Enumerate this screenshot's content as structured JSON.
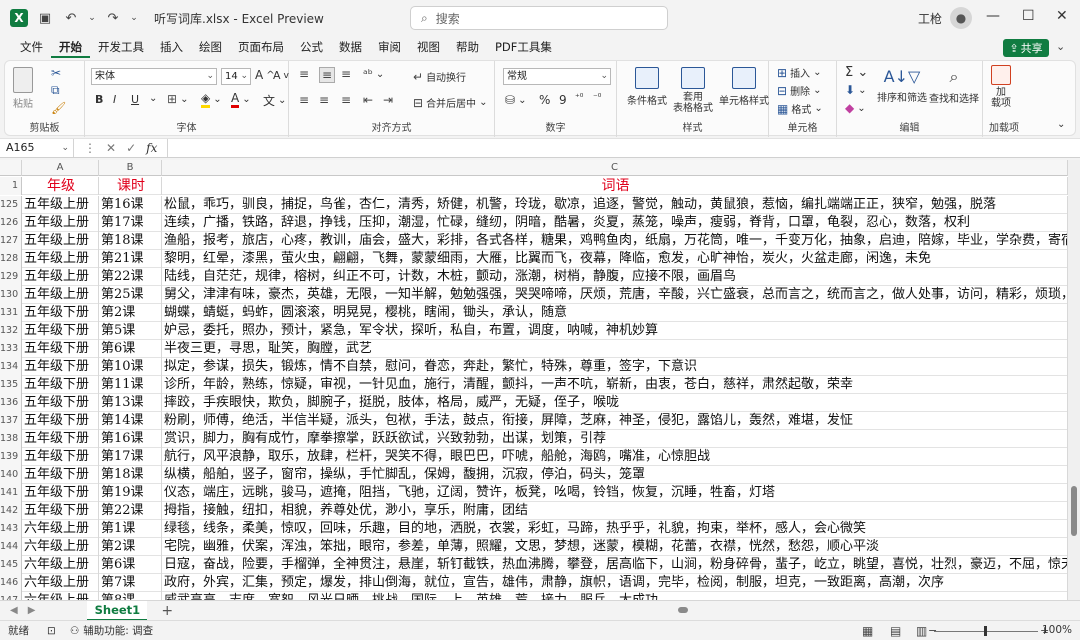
{
  "titlebar": {
    "title": "听写词库.xlsx  -  Excel Preview",
    "search_placeholder": "搜索",
    "user_name": "工枪",
    "minimize": "—",
    "maximize": "☐",
    "close": "✕"
  },
  "menu": [
    "文件",
    "开始",
    "开发工具",
    "插入",
    "绘图",
    "页面布局",
    "公式",
    "数据",
    "审阅",
    "视图",
    "帮助",
    "PDF工具集"
  ],
  "share_label": "共享",
  "ribbon": {
    "clipboard": {
      "label": "剪贴板",
      "paste": "粘贴"
    },
    "font": {
      "label": "字体",
      "font_name": "宋体",
      "font_size": "14",
      "bold": "B",
      "italic": "I",
      "underline": "U"
    },
    "alignment": {
      "label": "对齐方式",
      "wrap": "自动换行",
      "merge": "合并后居中"
    },
    "number": {
      "label": "数字",
      "format": "常规"
    },
    "styles": {
      "label": "样式",
      "conditional": "条件格式",
      "table": "套用\n表格格式",
      "cell_styles": "单元格样式"
    },
    "cells": {
      "label": "单元格",
      "insert": "插入",
      "delete": "删除",
      "format": "格式"
    },
    "editing": {
      "label": "编辑",
      "sort": "排序和筛选",
      "find": "查找和选择"
    },
    "addins": {
      "label": "加载项",
      "addin": "加\n载项"
    }
  },
  "formula_bar": {
    "name_box": "A165",
    "fx": "fx",
    "content": ""
  },
  "columns": [
    "A",
    "B",
    "C"
  ],
  "header_row": {
    "num": "1",
    "a": "年级",
    "b": "课时",
    "c": "词语"
  },
  "rows": [
    {
      "num": "125",
      "a": "五年级上册",
      "b": "第16课",
      "c": "松鼠，乖巧，驯良，捕捉，鸟雀，杏仁，清秀，矫健，机警，玲珑，歇凉，追逐，警觉，触动，黄鼠狼，惹恼，编扎端端正正，狭窄，勉强，脱落"
    },
    {
      "num": "126",
      "a": "五年级上册",
      "b": "第17课",
      "c": "连续，广播，铁路，辞退，挣钱，压抑，潮湿，忙碌，缝纫，阴暗，酷暑，炎夏，蒸笼，噪声，瘦弱，脊背，口罩，龟裂，忍心，数落，权利"
    },
    {
      "num": "127",
      "a": "五年级上册",
      "b": "第18课",
      "c": "渔船，报考，旅店，心疼，教训，庙会，盛大，彩排，各式各样，糖果，鸡鸭鱼肉，纸扇，万花筒，唯一，千变万化，抽象，启迪，陪嫁，毕业，学杂费，寄宿，品尝，法宝"
    },
    {
      "num": "128",
      "a": "五年级上册",
      "b": "第21课",
      "c": "黎明，红晕，漆黑，萤火虫，翩翩，飞舞，蒙蒙细雨，大雁，比翼而飞，夜幕，降临，愈发，心旷神怡，炭火，火盆走廊，闲逸，未免"
    },
    {
      "num": "129",
      "a": "五年级上册",
      "b": "第22课",
      "c": "陆线，自茫茫，规律，榕树，纠正不可，计数，木桩，颤动，涨潮，树梢，静腹，应接不限，画眉鸟"
    },
    {
      "num": "130",
      "a": "五年级上册",
      "b": "第25课",
      "c": "舅父，津津有味，豪杰，英雄，无限，一知半解，勉勉强强，哭哭啼啼，厌烦，荒唐，辛酸，兴亡盛衰，总而言之，统而言之，做人处事，访问，精彩，烦琐，索然无味"
    },
    {
      "num": "131",
      "a": "五年级下册",
      "b": "第2课",
      "c": "蝴蝶，蜻蜓，蚂蚱，圆滚滚，明晃晃，樱桃，瞎闹，锄头，承认，随意"
    },
    {
      "num": "132",
      "a": "五年级下册",
      "b": "第5课",
      "c": "妒忌，委托，照办，预计，紧急，军令状，探听，私自，布置，调度，呐喊，神机妙算"
    },
    {
      "num": "133",
      "a": "五年级下册",
      "b": "第6课",
      "c": "半夜三更，寻思，耻笑，胸膛，武艺"
    },
    {
      "num": "134",
      "a": "五年级下册",
      "b": "第10课",
      "c": "拟定，参谋，损失，锻炼，情不自禁，慰问，眷恋，奔赴，繁忙，特殊，尊重，签字，下意识"
    },
    {
      "num": "135",
      "a": "五年级下册",
      "b": "第11课",
      "c": "诊所，年龄，熟练，惊疑，审视，一针见血，施行，清醒，颤抖，一声不吭，崭新，由衷，苍白，慈祥，肃然起敬，荣幸"
    },
    {
      "num": "136",
      "a": "五年级下册",
      "b": "第13课",
      "c": "摔跤，手疾眼快，欺负，脚腕子，挺脱，肢体，格局，威严，无疑，侄子，喉咙"
    },
    {
      "num": "137",
      "a": "五年级下册",
      "b": "第14课",
      "c": "粉刷，师傅，绝活，半信半疑，派头，包袱，手法，鼓点，衔接，屏障，芝麻，神圣，侵犯，露馅儿，轰然，难堪，发怔"
    },
    {
      "num": "138",
      "a": "五年级下册",
      "b": "第16课",
      "c": "赏识，脚力，胸有成竹，摩拳擦掌，跃跃欲试，兴致勃勃，出谋，划策，引荐"
    },
    {
      "num": "139",
      "a": "五年级下册",
      "b": "第17课",
      "c": "航行，风平浪静，取乐，放肆，栏杆，哭笑不得，眼巴巴，吓唬，船舱，海鸥，嘴准，心惊胆战"
    },
    {
      "num": "140",
      "a": "五年级下册",
      "b": "第18课",
      "c": "纵横，船舶，竖子，窗帘，操纵，手忙脚乱，保姆，馥拥，沉寂，停泊，码头，笼罩"
    },
    {
      "num": "141",
      "a": "五年级下册",
      "b": "第19课",
      "c": "仪态，端庄，远眺，骏马，遮掩，阻挡，飞驰，辽阔，赞许，板凳，吆喝，铃铛，恢复，沉睡，牲畜，灯塔"
    },
    {
      "num": "142",
      "a": "五年级下册",
      "b": "第22课",
      "c": "拇指，接触，纽扣，相貌，养尊处优，渺小，享乐，附庸，团结"
    },
    {
      "num": "143",
      "a": "六年级上册",
      "b": "第1课",
      "c": "绿毯，线条，柔美，惊叹，回味，乐趣，目的地，洒脱，衣裳，彩虹，马蹄，热乎乎，礼貌，拘束，举杯，感人，会心微笑"
    },
    {
      "num": "144",
      "a": "六年级上册",
      "b": "第2课",
      "c": "宅院，幽雅，伏案，浑浊，笨拙，眼帘，参差，单薄，照耀，文思，梦想，迷蒙，模糊，花蕾，衣襟，恍然，愁怨，顺心平淡"
    },
    {
      "num": "145",
      "a": "六年级上册",
      "b": "第6课",
      "c": "日寇，奋战，险要，手榴弹，全神贯注，悬崖，斩钉截铁，热血沸腾，攀登，居高临下，山涧，粉身碎骨，蜚子，屹立，眺望，喜悦，壮烈，豪迈，不屈，惊天动地"
    },
    {
      "num": "146",
      "a": "六年级上册",
      "b": "第7课",
      "c": "政府，外宾，汇集，预定，爆发，排山倒海，就位，宣告，雄伟，肃静，旗帜，语调，完毕，检阅，制服，坦克，一致距离，高潮，次序"
    },
    {
      "num": "147",
      "a": "六年级上册",
      "b": "第8课",
      "c": "威武高高，志度，宽恕，风光日晒，挑战，国际，上，英雄，荒，接力，服兵，大成功，"
    }
  ],
  "sheet": {
    "tab": "Sheet1",
    "add": "+"
  },
  "status": {
    "ready": "就绪",
    "accessibility": "辅助功能: 调查",
    "zoom": "100%"
  }
}
